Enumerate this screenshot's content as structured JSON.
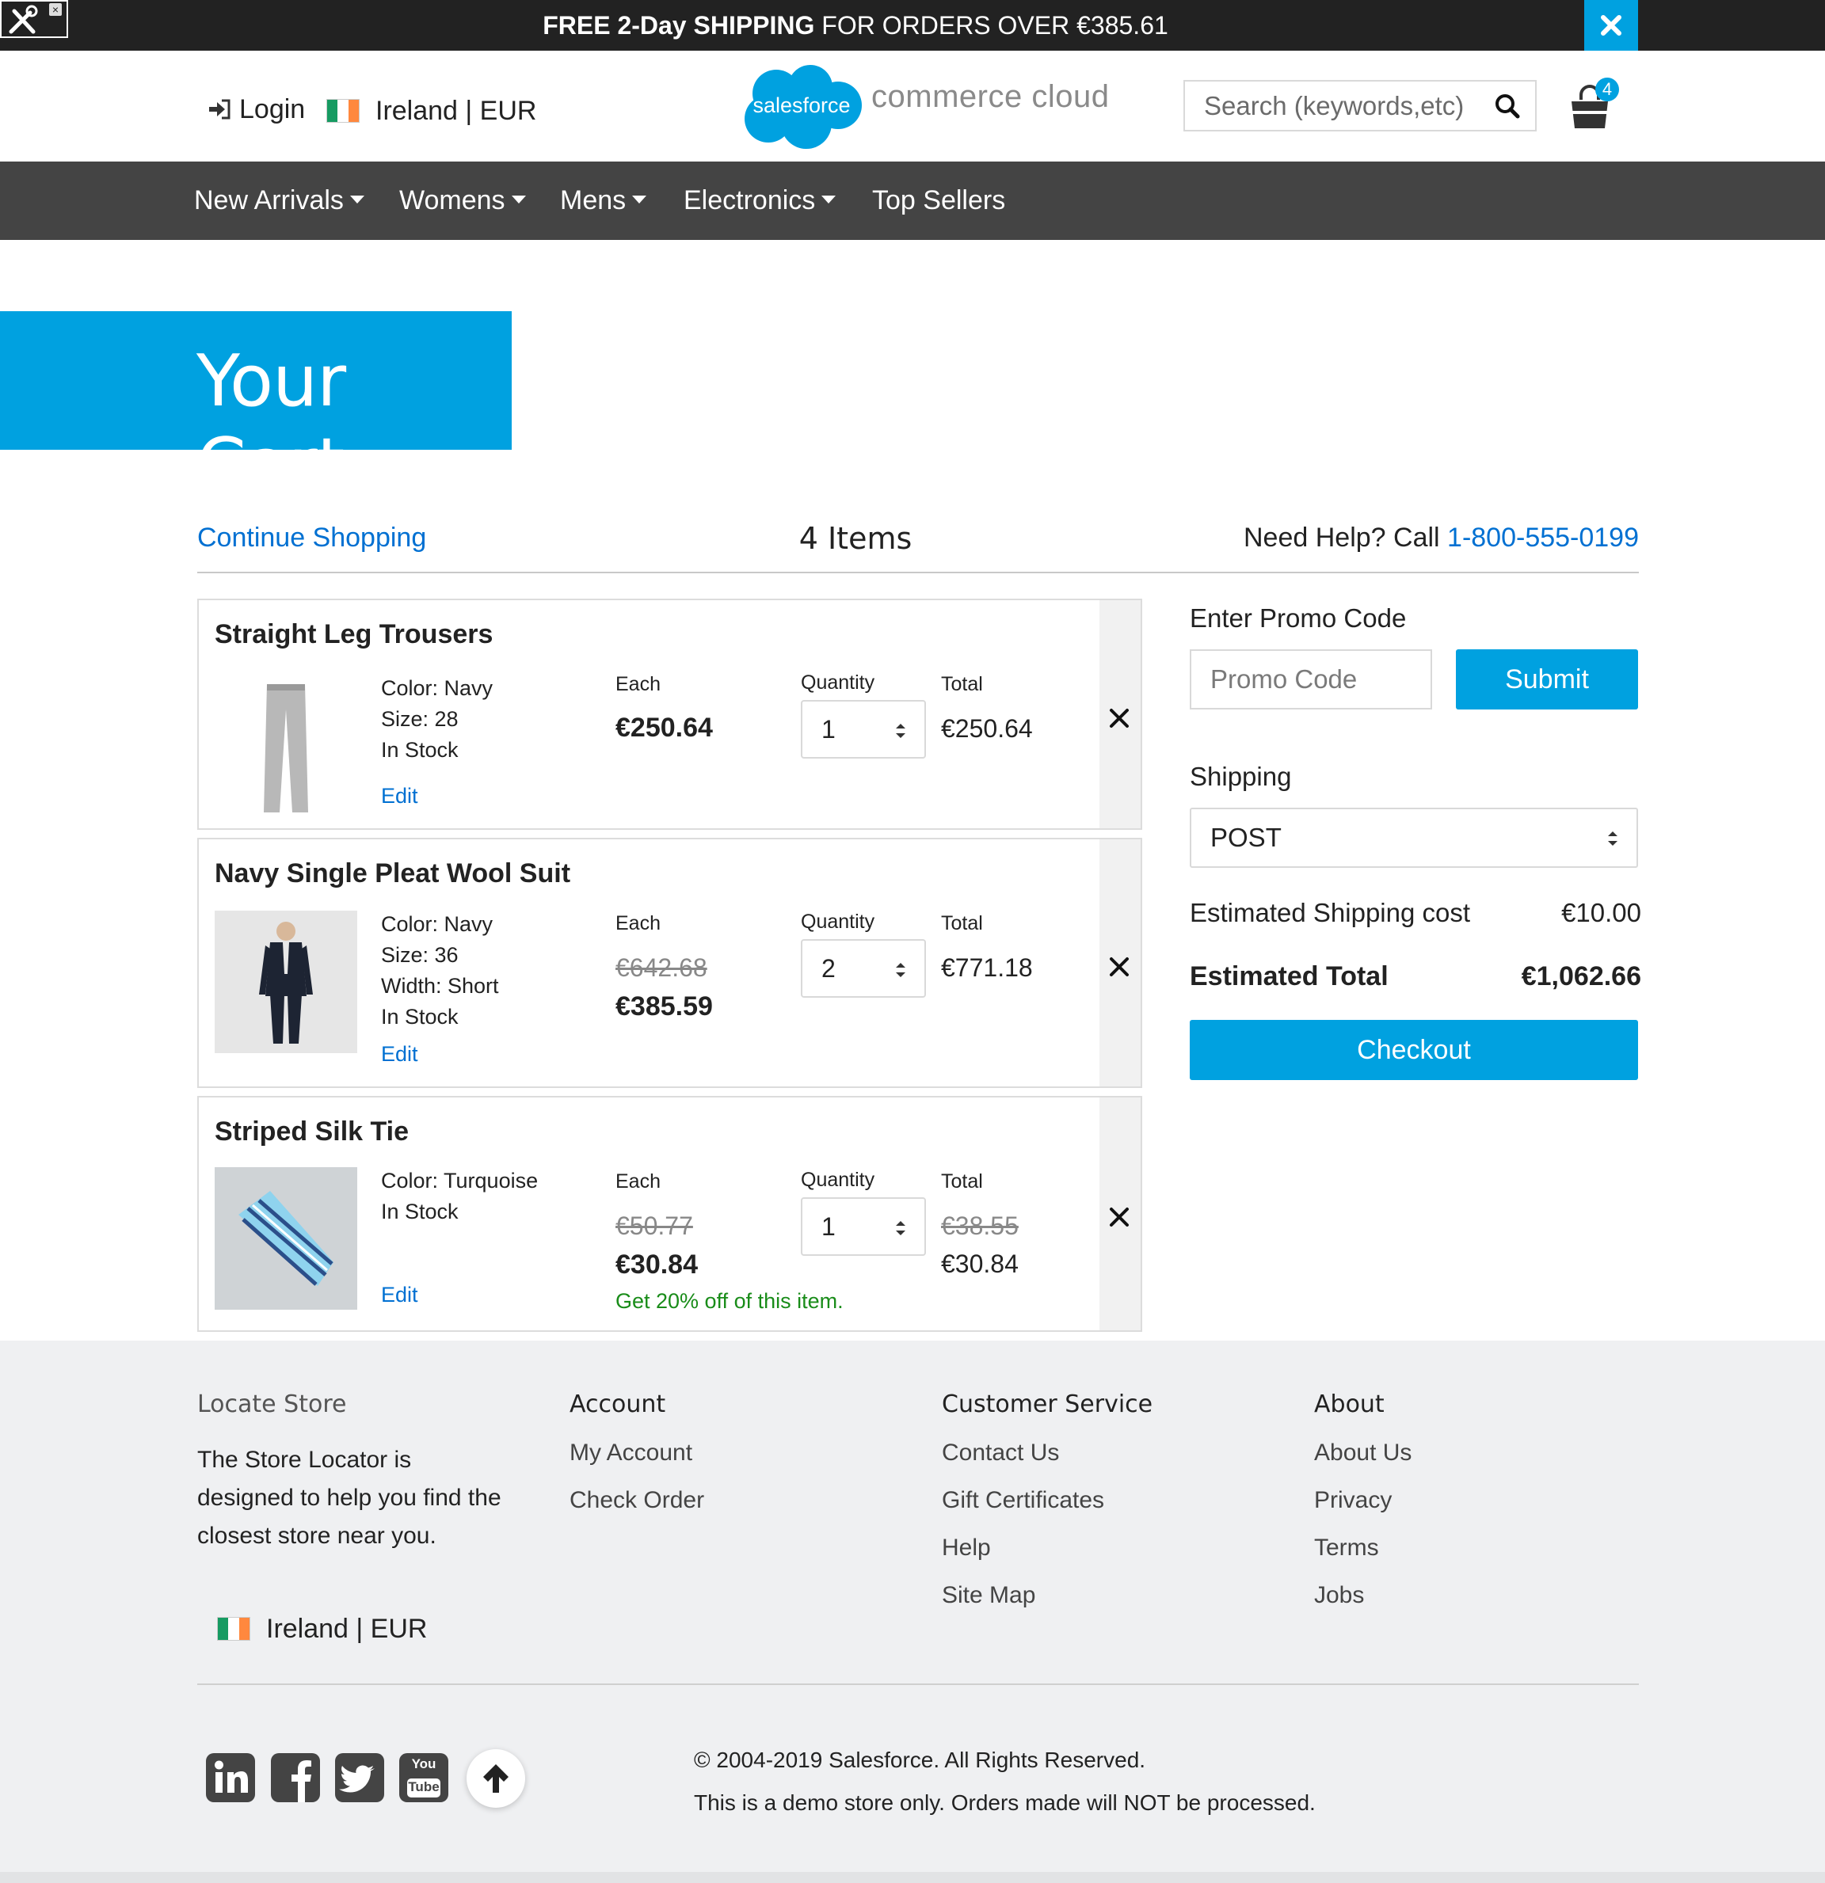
{
  "banner": {
    "bold": "FREE 2-Day SHIPPING",
    "text": " FOR ORDERS OVER €385.61"
  },
  "header": {
    "login": "Login",
    "locale": "Ireland | EUR",
    "logo_badge": "salesforce",
    "logo_text": "commerce cloud",
    "search_placeholder": "Search (keywords,etc)",
    "cart_count": "4"
  },
  "nav": {
    "items": [
      {
        "label": "New Arrivals"
      },
      {
        "label": "Womens"
      },
      {
        "label": "Mens"
      },
      {
        "label": "Electronics"
      },
      {
        "label": "Top Sellers"
      }
    ]
  },
  "page": {
    "title": "Your Cart",
    "continue_shopping": "Continue Shopping",
    "items_count": "4 Items",
    "help_text": "Need Help? Call ",
    "help_phone": "1-800-555-0199"
  },
  "labels": {
    "each": "Each",
    "quantity": "Quantity",
    "total": "Total",
    "edit": "Edit"
  },
  "products": [
    {
      "name": "Straight Leg Trousers",
      "attrs": [
        "Color: Navy",
        "Size: 28",
        "In Stock"
      ],
      "price": "€250.64",
      "quantity": "1",
      "total": "€250.64"
    },
    {
      "name": "Navy Single Pleat Wool Suit",
      "attrs": [
        "Color: Navy",
        "Size: 36",
        "Width: Short",
        "In Stock"
      ],
      "price_original": "€642.68",
      "price": "€385.59",
      "quantity": "2",
      "total": "€771.18"
    },
    {
      "name": "Striped Silk Tie",
      "attrs": [
        "Color: Turquoise",
        "In Stock"
      ],
      "price_original": "€50.77",
      "price": "€30.84",
      "quantity": "1",
      "total_original": "€38.55",
      "total": "€30.84",
      "promo": "Get 20% off of this item."
    }
  ],
  "summary": {
    "promo_title": "Enter Promo Code",
    "promo_placeholder": "Promo Code",
    "submit": "Submit",
    "shipping_title": "Shipping",
    "shipping_method": "POST",
    "est_shipping_label": "Estimated Shipping cost",
    "est_shipping_value": "€10.00",
    "est_total_label": "Estimated Total",
    "est_total_value": "€1,062.66",
    "checkout": "Checkout"
  },
  "footer": {
    "locate_title": "Locate Store",
    "locate_desc": "The Store Locator is designed to help you find the closest store near you.",
    "locale": "Ireland | EUR",
    "account_title": "Account",
    "account_links": [
      "My Account",
      "Check Order"
    ],
    "service_title": "Customer Service",
    "service_links": [
      "Contact Us",
      "Gift Certificates",
      "Help",
      "Site Map"
    ],
    "about_title": "About",
    "about_links": [
      "About Us",
      "Privacy",
      "Terms",
      "Jobs"
    ],
    "copyright": "© 2004-2019 Salesforce. All Rights Reserved.",
    "disclaimer": "This is a demo store only. Orders made will NOT be processed.",
    "social": [
      "linkedin-icon",
      "facebook-icon",
      "twitter-icon",
      "youtube-icon"
    ],
    "youtube_you": "You",
    "youtube_tube": "Tube"
  },
  "colors": {
    "accent": "#00a1e0",
    "link": "#0070d2",
    "dark_bar": "#222222",
    "nav_bg": "#444444",
    "promo_green": "#198c19"
  }
}
